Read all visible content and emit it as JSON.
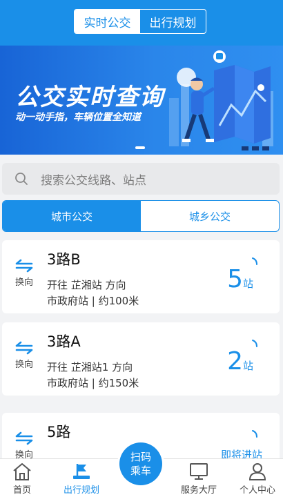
{
  "header": {
    "tabs": [
      {
        "label": "实时公交",
        "active": true
      },
      {
        "label": "出行规划",
        "active": false
      }
    ]
  },
  "banner": {
    "title": "公交实时查询",
    "subtitle": "动一动手指，车辆位置全知道"
  },
  "search": {
    "placeholder": "搜索公交线路、站点"
  },
  "category_tabs": [
    {
      "label": "城市公交",
      "active": true
    },
    {
      "label": "城乡公交",
      "active": false
    }
  ],
  "routes": [
    {
      "swap_label": "换向",
      "name": "3路B",
      "direction": "开往 芷湘站 方向",
      "stop": "市政府站 | 约100米",
      "eta_value": "5",
      "eta_unit": "站"
    },
    {
      "swap_label": "换向",
      "name": "3路A",
      "direction": "开往 芷湘站1 方向",
      "stop": "市政府站 | 约150米",
      "eta_value": "2",
      "eta_unit": "站"
    },
    {
      "swap_label": "换向",
      "name": "5路",
      "eta_text": "即将进站"
    }
  ],
  "scan_button": {
    "line1": "扫码",
    "line2": "乘车"
  },
  "bottom_nav": [
    {
      "label": "首页",
      "icon": "home-icon",
      "active": false
    },
    {
      "label": "出行规划",
      "icon": "flag-icon",
      "active": true
    },
    {
      "label": "服务大厅",
      "icon": "monitor-icon",
      "active": false
    },
    {
      "label": "个人中心",
      "icon": "user-icon",
      "active": false
    }
  ],
  "colors": {
    "primary": "#1a8fe8",
    "background": "#f2f3f5"
  }
}
